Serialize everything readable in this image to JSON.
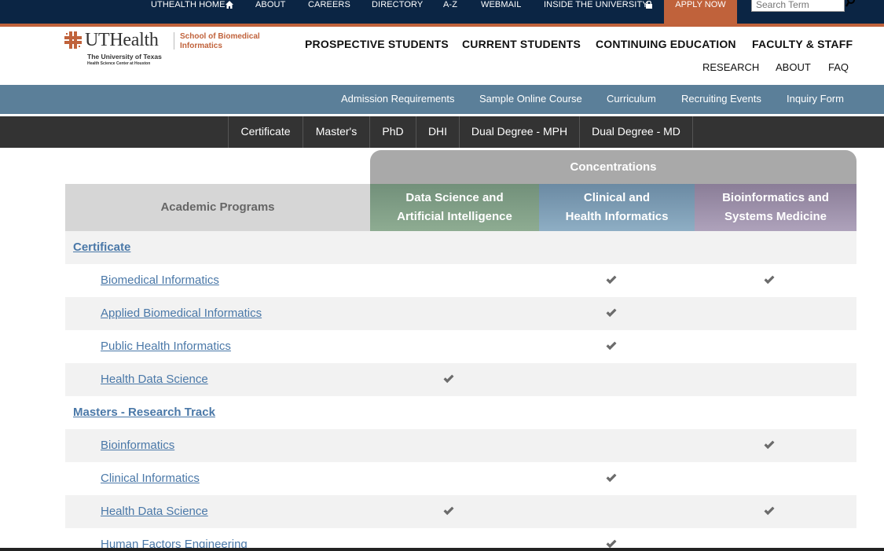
{
  "topbar": {
    "links": [
      "UTHEALTH HOME",
      "ABOUT",
      "CAREERS",
      "DIRECTORY",
      "A-Z",
      "WEBMAIL",
      "INSIDE THE UNIVERSITY"
    ],
    "apply": "APPLY NOW",
    "search_placeholder": "Search Term",
    "colors": {
      "navy": "#0b2544",
      "accent": "#c0623b"
    }
  },
  "logo": {
    "wordmark": "UTHealth",
    "school": "School of Biomedical Informatics",
    "university": "The University of Texas",
    "campus": "Health Science Center at Houston"
  },
  "mainnav": [
    "PROSPECTIVE STUDENTS",
    "CURRENT STUDENTS",
    "CONTINUING EDUCATION",
    "FACULTY & STAFF"
  ],
  "subnav": [
    "RESEARCH",
    "ABOUT",
    "FAQ"
  ],
  "bluebar": [
    "Admission Requirements",
    "Sample Online Course",
    "Curriculum",
    "Recruiting Events",
    "Inquiry Form"
  ],
  "degree_tabs": [
    "Certificate",
    "Master's",
    "PhD",
    "DHI",
    "Dual Degree - MPH",
    "Dual Degree - MD"
  ],
  "table": {
    "concentrations_label": "Concentrations",
    "programs_label": "Academic Programs",
    "columns": [
      {
        "line1": "Data Science and",
        "line2": "Artificial Intelligence",
        "color": "#7f9d86"
      },
      {
        "line1": "Clinical and",
        "line2": "Health Informatics",
        "color": "#7d9cb4"
      },
      {
        "line1": "Bioinformatics and",
        "line2": "Systems Medicine",
        "color": "#9c90a9"
      }
    ],
    "rows": [
      {
        "label": "Certificate",
        "section": true,
        "checks": [
          false,
          false,
          false
        ]
      },
      {
        "label": "Biomedical Informatics",
        "section": false,
        "checks": [
          false,
          true,
          true
        ]
      },
      {
        "label": "Applied Biomedical Informatics",
        "section": false,
        "checks": [
          false,
          true,
          false
        ]
      },
      {
        "label": "Public Health Informatics",
        "section": false,
        "checks": [
          false,
          true,
          false
        ]
      },
      {
        "label": "Health Data Science",
        "section": false,
        "checks": [
          true,
          false,
          false
        ]
      },
      {
        "label": "Masters - Research Track",
        "section": true,
        "checks": [
          false,
          false,
          false
        ]
      },
      {
        "label": "Bioinformatics",
        "section": false,
        "checks": [
          false,
          false,
          true
        ]
      },
      {
        "label": "Clinical Informatics",
        "section": false,
        "checks": [
          false,
          true,
          false
        ]
      },
      {
        "label": "Health Data Science",
        "section": false,
        "checks": [
          true,
          false,
          true
        ]
      },
      {
        "label": "Human Factors Engineering",
        "section": false,
        "checks": [
          false,
          true,
          false
        ]
      }
    ]
  }
}
